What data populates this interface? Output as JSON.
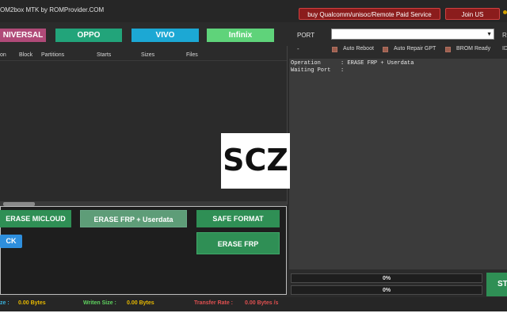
{
  "title": "OM2box MTK by ROMProvider.COM",
  "top_buttons": {
    "remote_service": "buy Qualcomm/unisoc/Remote Paid Service",
    "join_us": "Join US"
  },
  "brand_tabs": [
    "NIVERSAL",
    "OPPO",
    "VIVO",
    "Infinix"
  ],
  "table": {
    "columns": [
      "on",
      "Block",
      "Partitions",
      "Starts",
      "Sizes",
      "Files"
    ]
  },
  "actions": {
    "erase_micloud": "ERASE MICLOUD",
    "erase_frp_userdata": "ERASE FRP + Userdata",
    "safe_format": "SAFE FORMAT",
    "lock": "CK",
    "erase_frp": "ERASE FRP"
  },
  "port": {
    "label": "PORT",
    "value": "",
    "dash": "-",
    "r_edge": "R",
    "id_edge": "ID"
  },
  "options": [
    "Auto Reboot",
    "Auto Repair GPT",
    "BROM Ready"
  ],
  "log": [
    "Operation      : ERASE FRP + Userdata",
    "Waiting Port   :"
  ],
  "progress": [
    {
      "text": "0%",
      "value": 0
    },
    {
      "text": "0%",
      "value": 0
    }
  ],
  "start_button": "ST",
  "status": {
    "size_label": "ze :",
    "size_value": "0.00 Bytes",
    "written_label": "Writen Size :",
    "written_value": "0.00 Bytes",
    "rate_label": "Transfer Rate :",
    "rate_value": "0.00 Bytes /s"
  },
  "watermark": "SCZ",
  "colors": {
    "accent_green": "#2f8f55",
    "alert_red": "#8b1c1c",
    "status_label_cyan": "#3ab4e0",
    "status_label_green": "#5fd35f",
    "status_label_red": "#e05050",
    "status_value_yellow": "#e6b800"
  }
}
